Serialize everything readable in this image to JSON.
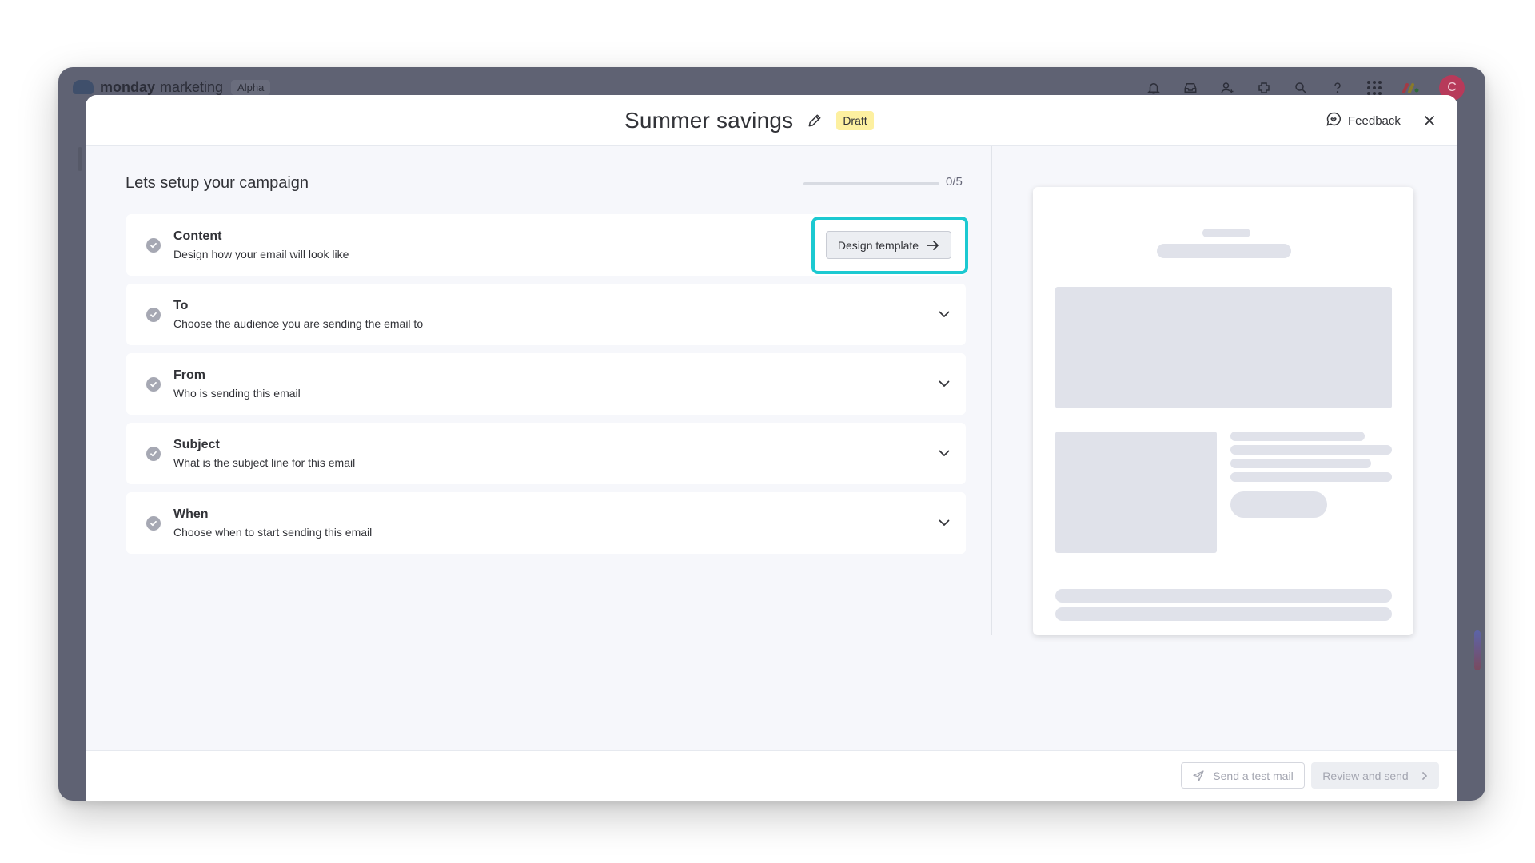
{
  "app": {
    "brand": "monday",
    "brand_sub": "marketing",
    "badge": "Alpha",
    "avatar_initial": "C",
    "icons": [
      "bell-icon",
      "inbox-icon",
      "invite-user-icon",
      "integrations-icon",
      "search-icon",
      "help-icon",
      "apps-grid-icon",
      "monday-logo-icon"
    ]
  },
  "modal": {
    "title": "Summer savings",
    "status_badge": "Draft",
    "feedback_label": "Feedback"
  },
  "setup": {
    "heading": "Lets setup your campaign",
    "progress_text": "0/5",
    "progress_fraction": 0,
    "steps": [
      {
        "title": "Content",
        "description": "Design how your email will look like",
        "action_label": "Design template"
      },
      {
        "title": "To",
        "description": "Choose the audience you are sending the email to"
      },
      {
        "title": "From",
        "description": "Who is sending this email"
      },
      {
        "title": "Subject",
        "description": "What is the subject line for this email"
      },
      {
        "title": "When",
        "description": "Choose when to start sending this email"
      }
    ]
  },
  "footer": {
    "send_test_label": "Send a test mail",
    "review_send_label": "Review and send"
  },
  "colors": {
    "highlight": "#1cc9d1",
    "draft_badge": "#fdf0a0",
    "backdrop": "#5f6273",
    "avatar": "#b73a5a"
  }
}
